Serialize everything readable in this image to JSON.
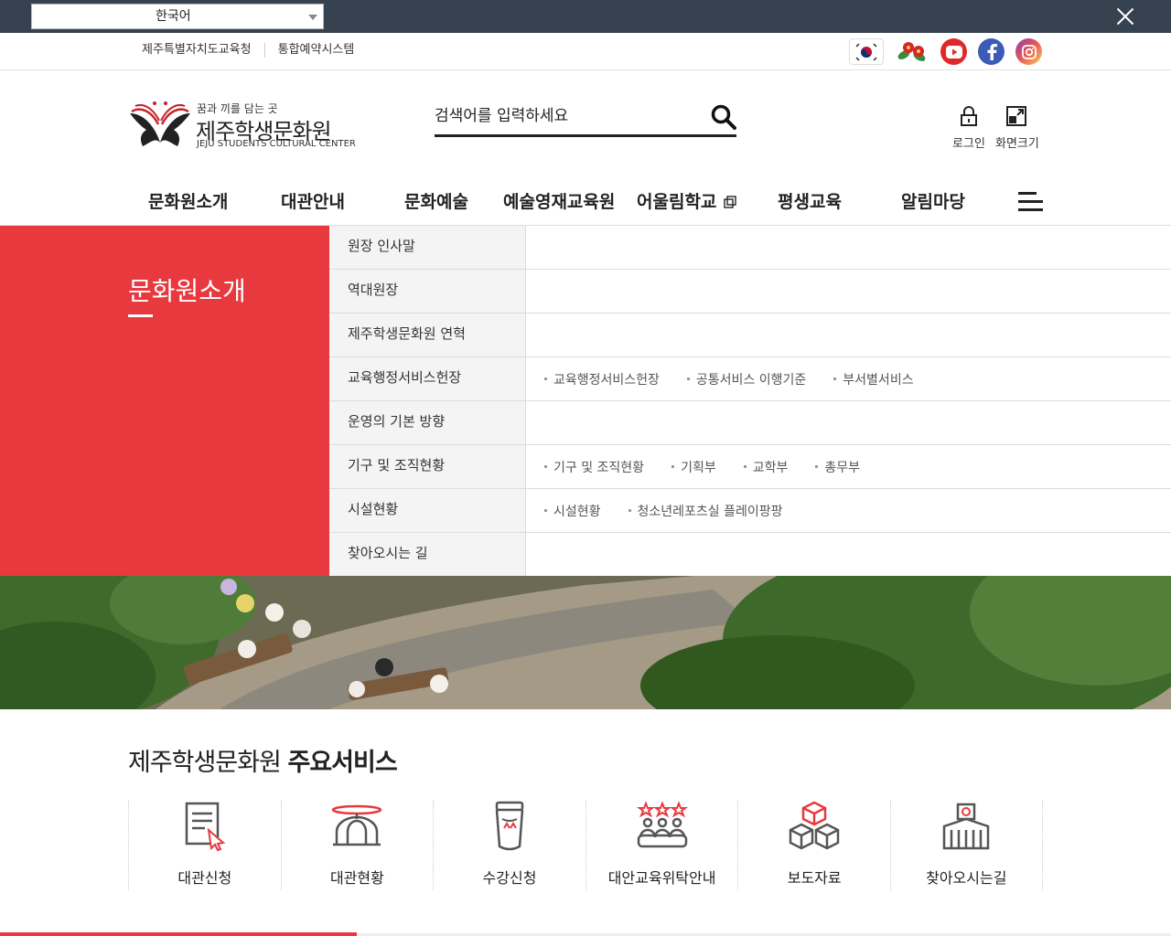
{
  "translate": {
    "selected_language": "한국어"
  },
  "util": {
    "links": [
      "제주특별자치도교육청",
      "통합예약시스템"
    ]
  },
  "header": {
    "slogan": "꿈과 끼를 담는 곳",
    "name": "제주학생문화원",
    "english_name": "JEJU STUDENTS CULTURAL CENTER",
    "search_placeholder": "검색어를 입력하세요",
    "login_label": "로그인",
    "screen_label": "화면크기"
  },
  "gnb": {
    "items": [
      "문화원소개",
      "대관안내",
      "문화예술",
      "예술영재교육원",
      "어울림학교",
      "평생교육",
      "알림마당"
    ]
  },
  "dropdown": {
    "title": "문화원소개",
    "rows": [
      {
        "label": "원장 인사말",
        "subs": []
      },
      {
        "label": "역대원장",
        "subs": []
      },
      {
        "label": "제주학생문화원 연혁",
        "subs": []
      },
      {
        "label": "교육행정서비스헌장",
        "subs": [
          "교육행정서비스헌장",
          "공통서비스 이행기준",
          "부서별서비스"
        ]
      },
      {
        "label": "운영의 기본 방향",
        "subs": []
      },
      {
        "label": "기구 및 조직현황",
        "subs": [
          "기구 및 조직현황",
          "기획부",
          "교학부",
          "총무부"
        ]
      },
      {
        "label": "시설현황",
        "subs": [
          "시설현황",
          "청소년레포츠실 플레이팡팡"
        ]
      },
      {
        "label": "찾아오시는 길",
        "subs": []
      }
    ]
  },
  "services": {
    "title_light": "제주학생문화원",
    "title_bold": "주요서비스",
    "items": [
      "대관신청",
      "대관현황",
      "수강신청",
      "대안교육위탁안내",
      "보도자료",
      "찾아오시는길"
    ]
  },
  "colors": {
    "accent": "#e8393e",
    "dark": "#36424f"
  }
}
